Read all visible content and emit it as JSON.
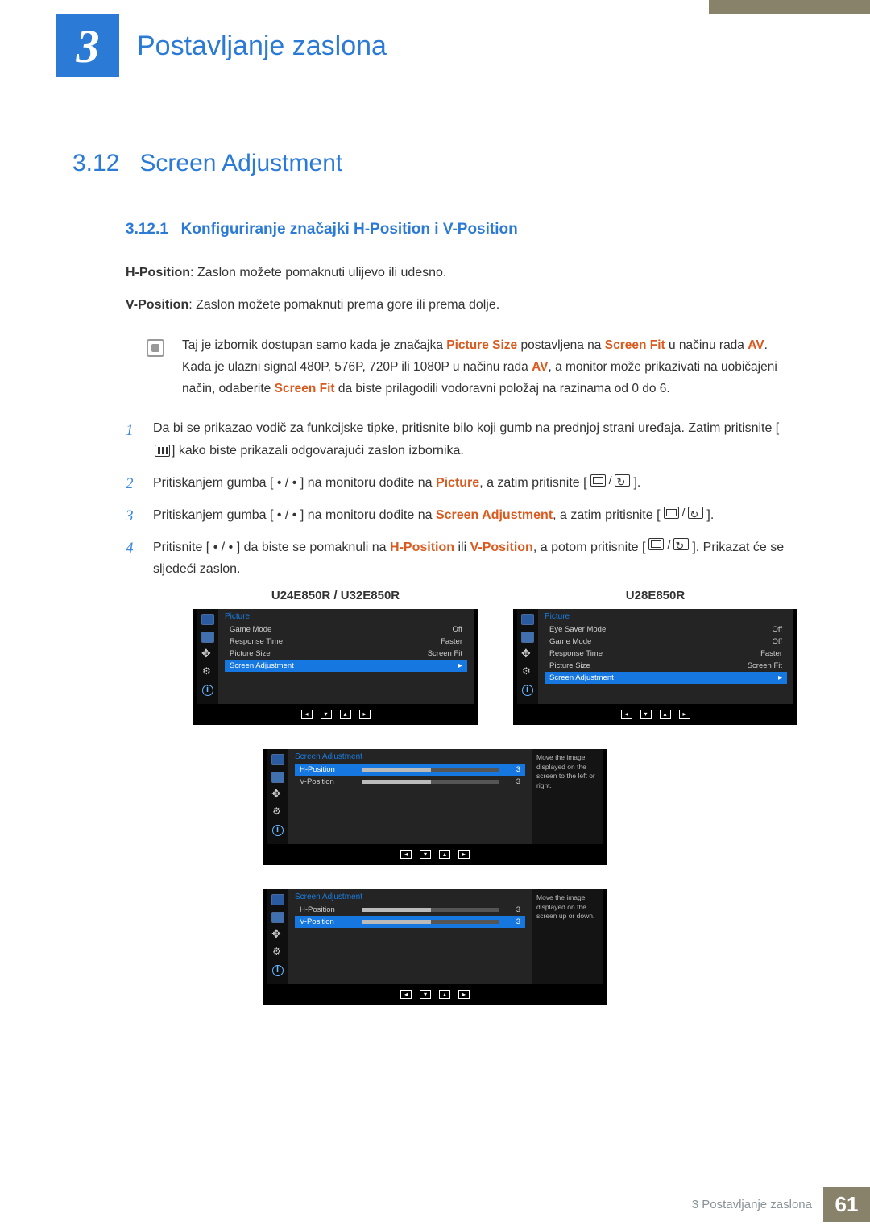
{
  "chapter": {
    "number": "3",
    "title": "Postavljanje zaslona"
  },
  "section": {
    "number": "3.12",
    "title": "Screen Adjustment"
  },
  "subsection": {
    "number": "3.12.1",
    "title": "Konfiguriranje značajki H-Position i V-Position"
  },
  "hpos_term": "H-Position",
  "hpos_text": ": Zaslon možete pomaknuti ulijevo ili udesno.",
  "vpos_term": "V-Position",
  "vpos_text": ": Zaslon možete pomaknuti prema gore ili prema dolje.",
  "note": {
    "a": "Taj je izbornik dostupan samo kada je značajka ",
    "b": "Picture Size",
    "c": " postavljena na ",
    "d": "Screen Fit",
    "e": " u načinu rada ",
    "f": "AV",
    "g": ". Kada je ulazni signal 480P, 576P, 720P ili 1080P u načinu rada ",
    "h": "AV",
    "i": ", a monitor može prikazivati na uobičajeni način, odaberite ",
    "j": "Screen Fit",
    "k": " da biste prilagodili vodoravni položaj na razinama od 0 do 6."
  },
  "steps": {
    "s1a": "Da bi se prikazao vodič za funkcijske tipke, pritisnite bilo koji gumb na prednjoj strani uređaja. Zatim pritisnite [",
    "s1b": "] kako biste prikazali odgovarajući zaslon izbornika.",
    "s2a": "Pritiskanjem gumba [",
    "dots": " • / • ",
    "s2b": "] na monitoru dođite na ",
    "s2c": "Picture",
    "s2d": ", a zatim pritisnite [",
    "s2e": "].",
    "s3a": "Pritiskanjem gumba [",
    "s3b": "] na monitoru dođite na ",
    "s3c": "Screen Adjustment",
    "s3d": ", a zatim pritisnite [",
    "s3e": "].",
    "s4a": "Pritisnite [",
    "s4b": "] da biste se pomaknuli na ",
    "s4c": "H-Position",
    "s4d": " ili ",
    "s4e": "V-Position",
    "s4f": ", a potom pritisnite [",
    "s4g": "]. Prikazat će se sljedeći zaslon."
  },
  "nums": {
    "n1": "1",
    "n2": "2",
    "n3": "3",
    "n4": "4"
  },
  "osd_labels": {
    "left": "U24E850R / U32E850R",
    "right": "U28E850R"
  },
  "osd_left": {
    "title": "Picture",
    "items": [
      {
        "label": "Game Mode",
        "value": "Off"
      },
      {
        "label": "Response Time",
        "value": "Faster"
      },
      {
        "label": "Picture Size",
        "value": "Screen Fit"
      },
      {
        "label": "Screen Adjustment",
        "value": "",
        "selected": true
      }
    ]
  },
  "osd_right": {
    "title": "Picture",
    "items": [
      {
        "label": "Eye Saver Mode",
        "value": "Off"
      },
      {
        "label": "Game Mode",
        "value": "Off"
      },
      {
        "label": "Response Time",
        "value": "Faster"
      },
      {
        "label": "Picture Size",
        "value": "Screen Fit"
      },
      {
        "label": "Screen Adjustment",
        "value": "",
        "selected": true
      }
    ]
  },
  "osd_hpos": {
    "title": "Screen Adjustment",
    "aside": "Move the image displayed on the screen to the left or right.",
    "sliders": [
      {
        "label": "H-Position",
        "value": "3",
        "pct": 50,
        "selected": true
      },
      {
        "label": "V-Position",
        "value": "3",
        "pct": 50,
        "selected": false
      }
    ]
  },
  "osd_vpos": {
    "title": "Screen Adjustment",
    "aside": "Move the image displayed on the screen up or down.",
    "sliders": [
      {
        "label": "H-Position",
        "value": "3",
        "pct": 50,
        "selected": false
      },
      {
        "label": "V-Position",
        "value": "3",
        "pct": 50,
        "selected": true
      }
    ]
  },
  "footer": {
    "text": "3 Postavljanje zaslona",
    "page": "61"
  }
}
